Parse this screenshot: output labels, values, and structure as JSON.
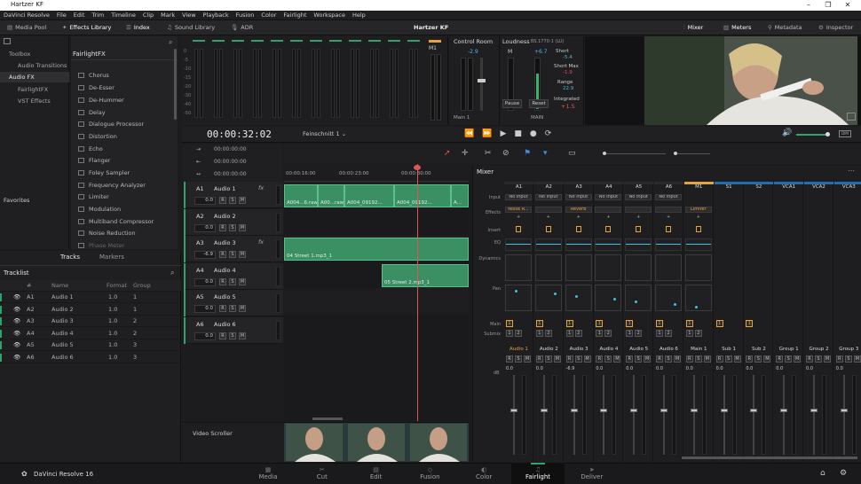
{
  "window": {
    "title": "Hartzer KF",
    "minimize": "–",
    "maximize": "❐",
    "close": "✕"
  },
  "menu": [
    "DaVinci Resolve",
    "File",
    "Edit",
    "Trim",
    "Timeline",
    "Clip",
    "Mark",
    "View",
    "Playback",
    "Fusion",
    "Color",
    "Fairlight",
    "Workspace",
    "Help"
  ],
  "toolbar": {
    "media_pool": "Media Pool",
    "effects_library": "Effects Library",
    "index": "Index",
    "sound_library": "Sound Library",
    "adr": "ADR",
    "project_title": "Hartzer KF",
    "mixer": "Mixer",
    "meters": "Meters",
    "metadata": "Metadata",
    "inspector": "Inspector"
  },
  "sidebar": {
    "toolbox": "Toolbox",
    "audio_transitions": "Audio Transitions",
    "audio_fx": "Audio FX",
    "fairlight_fx": "FairlightFX",
    "vst_effects": "VST Effects",
    "favorites": "Favorites"
  },
  "fx": {
    "header": "FairlightFX",
    "items": [
      "Chorus",
      "De-Esser",
      "De-Hummer",
      "Delay",
      "Dialogue Processor",
      "Distortion",
      "Echo",
      "Flanger",
      "Foley Sampler",
      "Frequency Analyzer",
      "Limiter",
      "Modulation",
      "Multiband Compressor",
      "Noise Reduction",
      "Phase Meter"
    ]
  },
  "tracklist": {
    "tab_tracks": "Tracks",
    "tab_markers": "Markers",
    "title": "Tracklist",
    "columns": [
      "#",
      "Name",
      "Format",
      "Group"
    ],
    "rows": [
      [
        "A1",
        "Audio 1",
        "1.0",
        "1"
      ],
      [
        "A2",
        "Audio 2",
        "1.0",
        "1"
      ],
      [
        "A3",
        "Audio 3",
        "1.0",
        "2"
      ],
      [
        "A4",
        "Audio 4",
        "1.0",
        "2"
      ],
      [
        "A5",
        "Audio 5",
        "1.0",
        "3"
      ],
      [
        "A6",
        "Audio 6",
        "1.0",
        "3"
      ]
    ]
  },
  "meters": {
    "ticks": [
      "0",
      "-5",
      "-10",
      "-15",
      "-20",
      "-30",
      "-40",
      "-50"
    ],
    "m1": "M1"
  },
  "control_room": {
    "title": "Control Room",
    "value": "-2.9",
    "m": "M",
    "main1": "Main 1",
    "main": "MAIN"
  },
  "loudness": {
    "title": "Loudness",
    "standard": "BS.1770-1 (LU)",
    "short": "Short",
    "short_val": "-5.4",
    "short_max": "Short Max",
    "short_max_val": "-1.9",
    "range": "Range",
    "range_val": "22.9",
    "integrated": "Integrated",
    "integrated_val": "+1.5",
    "top_val": "+6.7",
    "pause": "Pause",
    "reset": "Reset"
  },
  "timecode": "00:00:32:02",
  "timecodes": [
    "00:00:00:00",
    "00:00:00:00",
    "00:00:00:00"
  ],
  "timeline": {
    "name": "Feinschnitt 1",
    "ruler": [
      "00:00:16:00",
      "00:00:23:00",
      "00:00:30:00"
    ],
    "tracks": [
      {
        "id": "A1",
        "name": "Audio 1",
        "vol": "0.0"
      },
      {
        "id": "A2",
        "name": "Audio 2",
        "vol": "0.0"
      },
      {
        "id": "A3",
        "name": "Audio 3",
        "vol": "-6.9"
      },
      {
        "id": "A4",
        "name": "Audio 4",
        "vol": "0.0"
      },
      {
        "id": "A5",
        "name": "Audio 5",
        "vol": "0.0"
      },
      {
        "id": "A6",
        "name": "Audio 6",
        "vol": "0.0"
      }
    ],
    "clips": [
      "A004...6.raw",
      "A00...raw",
      "A004_09192...",
      "A004_09192...",
      "A...",
      "04 Street 1.mp3_1",
      "05 Street 2.mp3_1"
    ],
    "video_scroller": "Video Scroller",
    "fx_mark": "fx"
  },
  "mixer": {
    "title": "Mixer",
    "columns": [
      "A1",
      "A2",
      "A3",
      "A4",
      "A5",
      "A6",
      "M1",
      "S1",
      "S2",
      "VCA1",
      "VCA2",
      "VCA3"
    ],
    "row_labels": [
      "Input",
      "Effects",
      "Insert",
      "EQ",
      "Dynamics",
      "Pan",
      "Main",
      "Submix"
    ],
    "inputs": [
      "No Input",
      "No Input",
      "No Input",
      "No Input",
      "No Input",
      "No Input"
    ],
    "effects": [
      "Noise R...",
      "",
      "Reverb",
      "",
      "",
      "",
      "Limiter"
    ],
    "names": [
      "Audio 1",
      "Audio 2",
      "Audio 3",
      "Audio 4",
      "Audio 5",
      "Audio 6",
      "Main 1",
      "Sub 1",
      "Sub 2",
      "Group 1",
      "Group 2",
      "Group 3"
    ],
    "values": [
      "0.0",
      "0.0",
      "-6.9",
      "0.0",
      "0.0",
      "0.0",
      "0.0",
      "0.0",
      "0.0",
      "0.0",
      "0.0",
      "0.0"
    ],
    "db": "dB",
    "msr": [
      "R",
      "S",
      "M"
    ]
  },
  "pages": [
    "Media",
    "Cut",
    "Edit",
    "Fusion",
    "Color",
    "Fairlight",
    "Deliver"
  ],
  "app": "DaVinci Resolve 16",
  "accent": "#e7a33a",
  "active_green": "#2ea36b"
}
